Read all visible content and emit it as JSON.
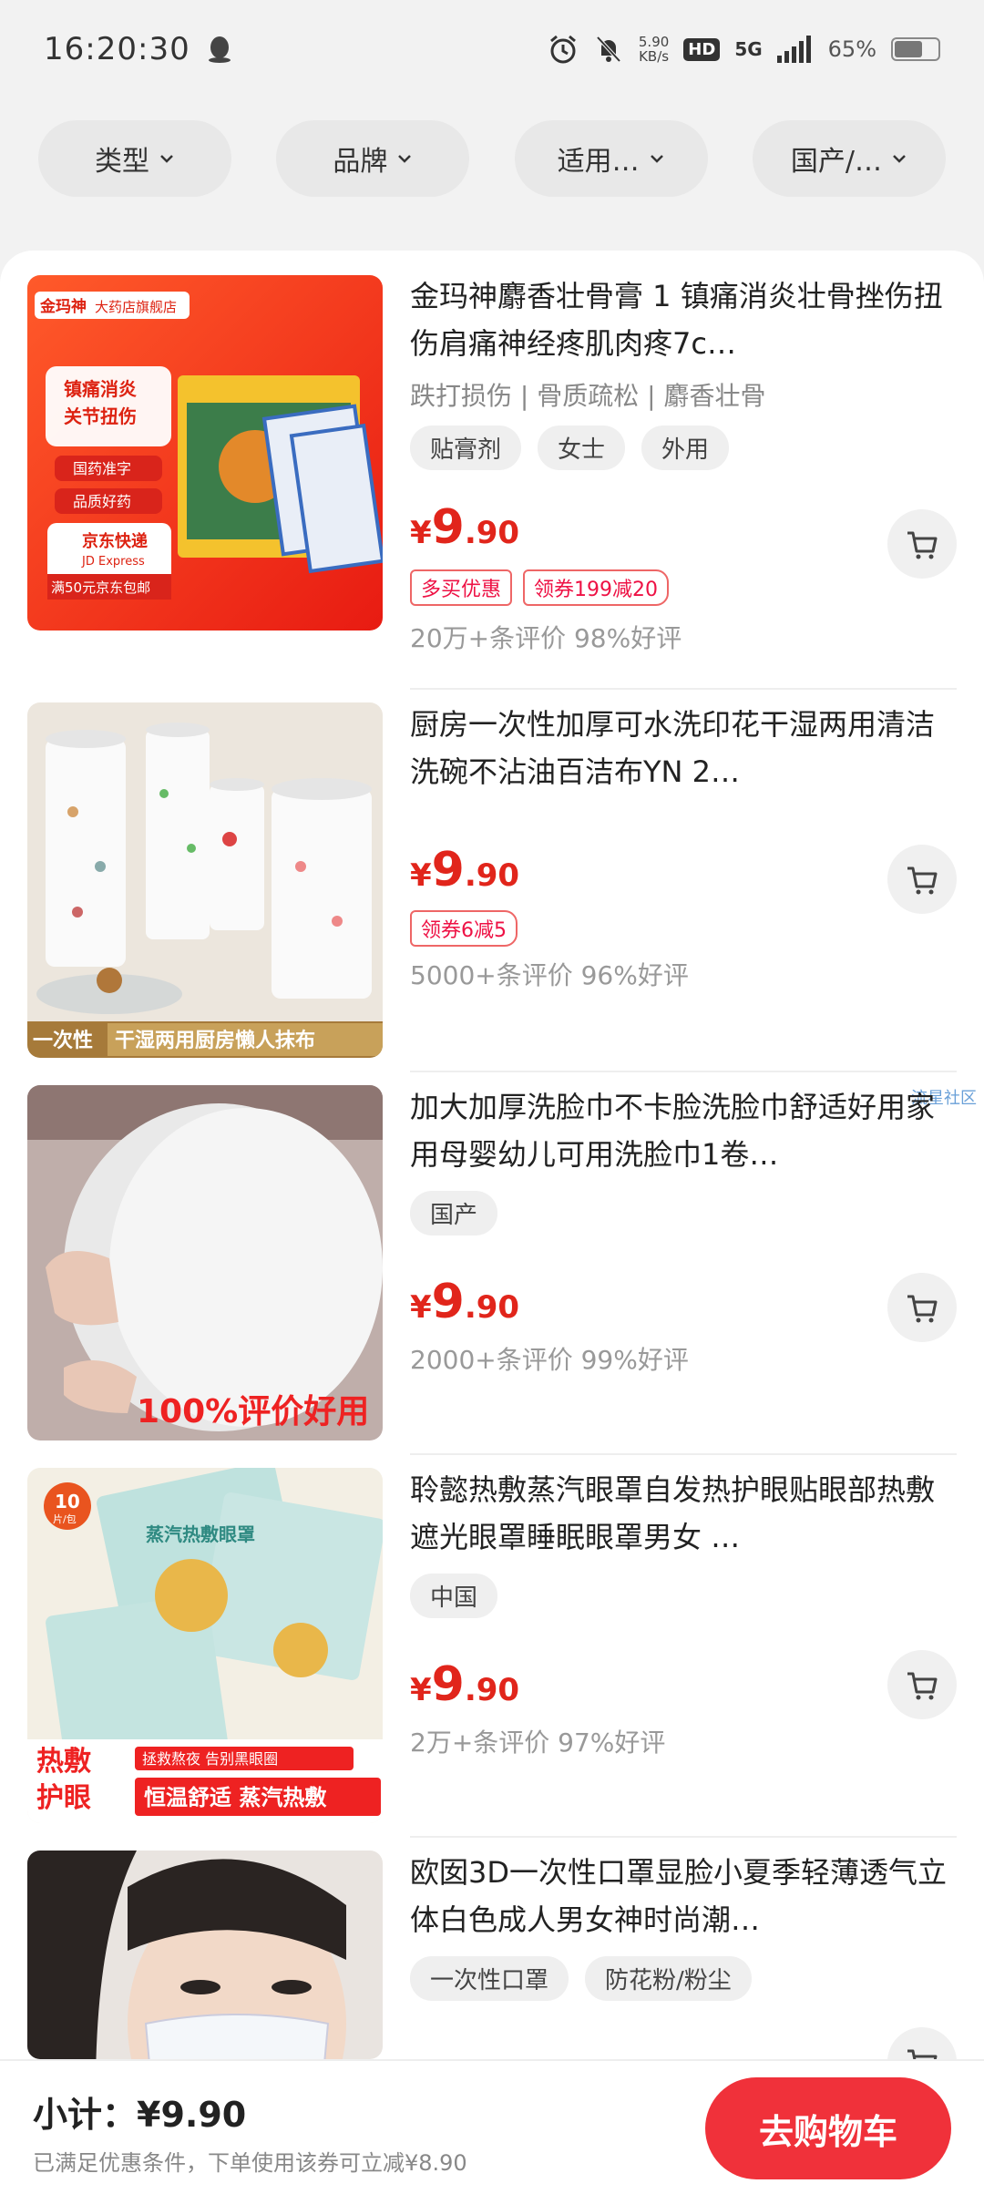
{
  "status": {
    "time": "16:20:30",
    "speed_value": "5.90",
    "speed_unit": "KB/s",
    "hd": "HD",
    "network": "5G",
    "battery": "65%",
    "battery_level": 0.65
  },
  "filters": [
    {
      "label": "类型"
    },
    {
      "label": "品牌"
    },
    {
      "label": "适用…"
    },
    {
      "label": "国产/…"
    }
  ],
  "products": [
    {
      "title": "金玛神麝香壮骨膏 1 镇痛消炎壮骨挫伤扭伤肩痛神经疼肌肉疼7c…",
      "subtitle": "跌打损伤 | 骨质疏松 | 麝香壮骨",
      "tags": [
        "贴膏剂",
        "女士",
        "外用"
      ],
      "price_symbol": "¥",
      "price_int": "9",
      "price_dec": ".90",
      "coupons": [
        "多买优惠",
        "领券199减20"
      ],
      "reviews": "20万+条评价  98%好评",
      "image_text": {
        "brand": "金玛神",
        "store": "大药店旗舰店",
        "line1": "镇痛消炎",
        "line2": "关节扭伤",
        "badge1": "国药准字",
        "badge2": "品质好药",
        "express": "京东快递",
        "express_en": "JD Express",
        "free": "满50元京东包邮"
      }
    },
    {
      "title": "厨房一次性加厚可水洗印花干湿两用清洁洗碗不沾油百洁布YN 2…",
      "subtitle": "",
      "tags": [],
      "price_symbol": "¥",
      "price_int": "9",
      "price_dec": ".90",
      "coupons": [
        "领券6减5"
      ],
      "reviews": "5000+条评价  96%好评",
      "image_text": {
        "left": "一次性",
        "right": "干湿两用厨房懒人抹布"
      }
    },
    {
      "title": "加大加厚洗脸巾不卡脸洗脸巾舒适好用家用母婴幼儿可用洗脸巾1卷…",
      "subtitle": "",
      "tags": [
        "国产"
      ],
      "price_symbol": "¥",
      "price_int": "9",
      "price_dec": ".90",
      "coupons": [],
      "reviews": "2000+条评价  99%好评",
      "corner_label": "流星社区",
      "image_text": {
        "caption": "100%评价好用"
      }
    },
    {
      "title": "聆懿热敷蒸汽眼罩自发热护眼贴眼部热敷遮光眼罩睡眠眼罩男女  …",
      "subtitle": "",
      "tags": [
        "中国"
      ],
      "price_symbol": "¥",
      "price_int": "9",
      "price_dec": ".90",
      "coupons": [],
      "reviews": "2万+条评价  97%好评",
      "image_text": {
        "count": "10",
        "count_unit": "片/包",
        "pack": "蒸汽热敷眼罩",
        "big1": "热敷",
        "big2": "护眼",
        "banner_top": "拯救熬夜 告别黑眼圈",
        "banner": "恒温舒适 蒸汽热敷"
      }
    },
    {
      "title": "欧囡3D一次性口罩显脸小夏季轻薄透气立体白色成人男女神时尚潮…",
      "subtitle": "",
      "tags": [
        "一次性口罩",
        "防花粉/粉尘"
      ],
      "price_symbol": "",
      "price_int": "",
      "price_dec": "",
      "coupons": [],
      "reviews": ""
    }
  ],
  "bottom": {
    "subtotal": "小计：¥9.90",
    "note": "已满足优惠条件，下单使用该券可立减¥8.90",
    "checkout": "去购物车"
  },
  "colors": {
    "accent": "#e1251b",
    "checkout": "#f0313a",
    "background": "#f2f2f2"
  }
}
